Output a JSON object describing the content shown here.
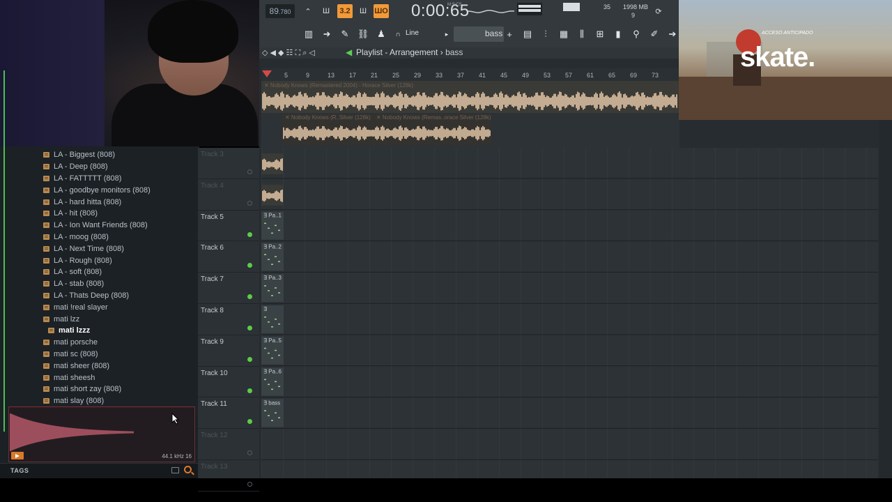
{
  "browser": {
    "items": [
      {
        "label": "LA - Biggest (808)",
        "indent": 1
      },
      {
        "label": "LA - Deep (808)",
        "indent": 1
      },
      {
        "label": "LA - FATTTTT (808)",
        "indent": 1
      },
      {
        "label": "LA - goodbye monitors (808)",
        "indent": 1
      },
      {
        "label": "LA - hard hitta (808)",
        "indent": 1
      },
      {
        "label": "LA - hit (808)",
        "indent": 1
      },
      {
        "label": "LA - Ion Want Friends (808)",
        "indent": 1
      },
      {
        "label": "LA - moog (808)",
        "indent": 1
      },
      {
        "label": "LA - Next Time (808)",
        "indent": 1
      },
      {
        "label": "LA - Rough (808)",
        "indent": 1
      },
      {
        "label": "LA - soft (808)",
        "indent": 1
      },
      {
        "label": "LA - stab (808)",
        "indent": 1
      },
      {
        "label": "LA - Thats Deep (808)",
        "indent": 1
      },
      {
        "label": "mati !real slayer",
        "indent": 1
      },
      {
        "label": "mati lzz",
        "indent": 1
      },
      {
        "label": "mati lzzz",
        "indent": 2,
        "selected": true
      },
      {
        "label": "mati porsche",
        "indent": 1
      },
      {
        "label": "mati sc (808)",
        "indent": 1
      },
      {
        "label": "mati sheer (808)",
        "indent": 1
      },
      {
        "label": "mati sheesh",
        "indent": 1
      },
      {
        "label": "mati short zay (808)",
        "indent": 1
      },
      {
        "label": "mati slay (808)",
        "indent": 1
      }
    ],
    "preview_info": "44.1 kHz 16",
    "tags_label": "TAGS"
  },
  "toolbar": {
    "tempo_main": "89",
    "tempo_frac": ".780",
    "time": "0:00:65",
    "time_unit": "M:S:CS",
    "cpu": "35",
    "memory": "1998 MB",
    "polyphony": "9",
    "snap": "Line",
    "pattern": "bass",
    "btn_step": "3.2",
    "btn_pat": "Ш",
    "btn_song": "ШО"
  },
  "playlist": {
    "title": "Playlist - Arrangement",
    "subtitle": "bass",
    "ruler_ticks": [
      "5",
      "9",
      "13",
      "17",
      "21",
      "25",
      "29",
      "33",
      "37",
      "41",
      "45",
      "49",
      "53",
      "57",
      "61",
      "65",
      "69",
      "73"
    ],
    "clip1_label": "Nobody Knows (Remastered 2004) - Horace Silver (128k)",
    "clip2a_label": "Nobody Knows (R..Silver (128k)",
    "clip2b_label": "Nobody Knows (Remas..orace Silver (128k)",
    "tracks": [
      {
        "name": "Track 3",
        "dim": true
      },
      {
        "name": "Track 4",
        "dim": true
      },
      {
        "name": "Track 5",
        "dim": false,
        "clip": "Pa..1"
      },
      {
        "name": "Track 6",
        "dim": false,
        "clip": "Pa..2"
      },
      {
        "name": "Track 7",
        "dim": false,
        "clip": "Pa..3"
      },
      {
        "name": "Track 8",
        "dim": false,
        "clip": ""
      },
      {
        "name": "Track 9",
        "dim": false,
        "clip": "Pa..5"
      },
      {
        "name": "Track 10",
        "dim": false,
        "clip": "Pa..6"
      },
      {
        "name": "Track 11",
        "dim": false,
        "clip": "bass"
      },
      {
        "name": "Track 12",
        "dim": true
      },
      {
        "name": "Track 13",
        "dim": true
      }
    ]
  },
  "game": {
    "logo": "skate.",
    "tag": "ACCESO ANTICIPADO"
  },
  "colors": {
    "accent": "#f09a3a",
    "waveform": "#f1d2b1",
    "active_led": "#5ccc46",
    "preview_wave": "#e06a7e"
  }
}
